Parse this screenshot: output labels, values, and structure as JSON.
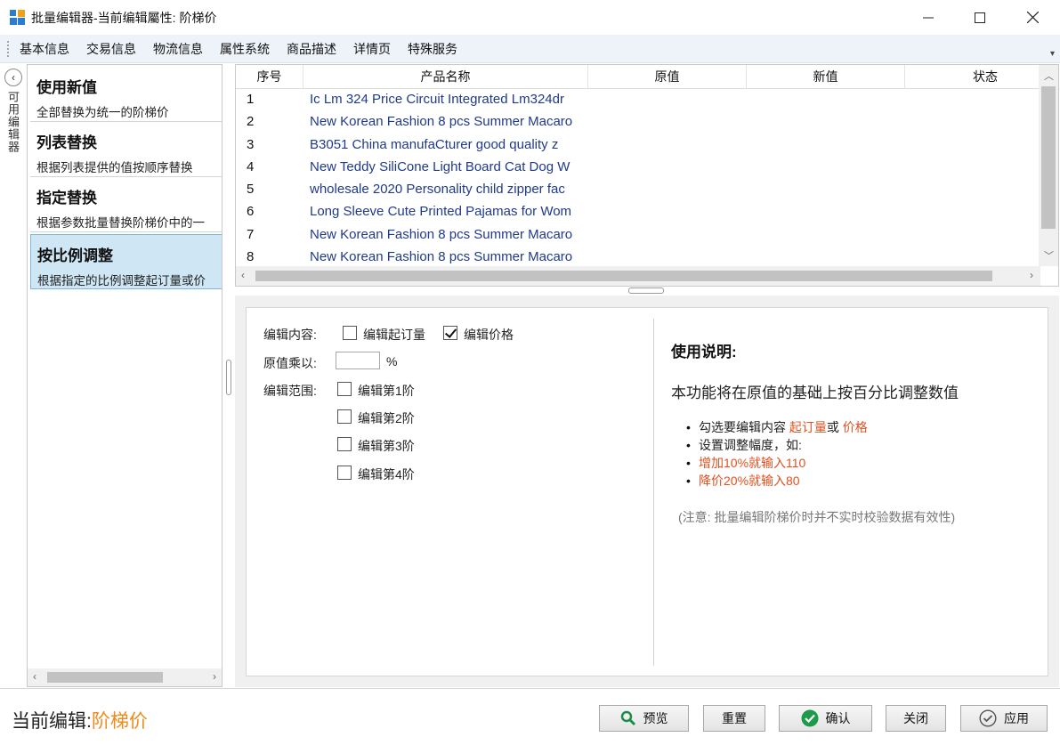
{
  "window": {
    "title": "批量编辑器-当前编辑屬性: 阶梯价",
    "minimize_icon": "minimize-icon",
    "maximize_icon": "maximize-icon",
    "close_icon": "close-icon"
  },
  "menu": {
    "items": [
      "基本信息",
      "交易信息",
      "物流信息",
      "属性系统",
      "商品描述",
      "详情页",
      "特殊服务"
    ]
  },
  "left_strip": {
    "collapse_icon": "chevron-left-icon",
    "label": "可用编辑器"
  },
  "editors": [
    {
      "title": "使用新值",
      "desc": "全部替换为统一的阶梯价"
    },
    {
      "title": "列表替换",
      "desc": "根据列表提供的值按顺序替换"
    },
    {
      "title": "指定替换",
      "desc": "根据参数批量替换阶梯价中的一"
    },
    {
      "title": "按比例调整",
      "desc": "根据指定的比例调整起订量或价",
      "selected": true
    }
  ],
  "table": {
    "headers": [
      "序号",
      "产品名称",
      "原值",
      "新值",
      "状态"
    ],
    "rows": [
      {
        "idx": "1",
        "name": "Ic Lm 324 Price Circuit Integrated Lm324dr"
      },
      {
        "idx": "2",
        "name": "New Korean Fashion 8 pcs Summer Macaro"
      },
      {
        "idx": "3",
        "name": "B3051 China manufaCturer good quality  z"
      },
      {
        "idx": "4",
        "name": "New Teddy SiliCone Light Board Cat  Dog W"
      },
      {
        "idx": "5",
        "name": "wholesale 2020 Personality child zipper fac"
      },
      {
        "idx": "6",
        "name": "Long Sleeve Cute Printed Pajamas for Wom"
      },
      {
        "idx": "7",
        "name": "New Korean Fashion 8 pcs Summer Macaro"
      },
      {
        "idx": "8",
        "name": "New Korean Fashion 8 pcs Summer Macaro"
      }
    ]
  },
  "form": {
    "content_label": "编辑内容:",
    "edit_qty_label": "编辑起订量",
    "edit_qty_checked": false,
    "edit_price_label": "编辑价格",
    "edit_price_checked": true,
    "multiply_label": "原值乘以:",
    "multiply_value": "",
    "percent_sign": "%",
    "range_label": "编辑范围:",
    "tiers": [
      {
        "label": "编辑第1阶",
        "checked": false
      },
      {
        "label": "编辑第2阶",
        "checked": false
      },
      {
        "label": "编辑第3阶",
        "checked": false
      },
      {
        "label": "编辑第4阶",
        "checked": false
      }
    ]
  },
  "help": {
    "title": "使用说明:",
    "main": "本功能将在原值的基础上按百分比调整数值",
    "bullet1_prefix": "勾选要编辑内容 ",
    "bullet1_qty": "起订量",
    "bullet1_or": "或 ",
    "bullet1_price": "价格",
    "bullet2": "设置调整幅度，如:",
    "bullet3": "增加10%就输入110",
    "bullet4": "降价20%就输入80",
    "note": "(注意: 批量编辑阶梯价时并不实时校验数据有效性)",
    "accent_color": "#e2501f"
  },
  "bottom": {
    "current_label": "当前编辑:",
    "current_value": "阶梯价",
    "current_value_color": "#f08a1c",
    "preview": "预览",
    "reset": "重置",
    "confirm": "确认",
    "close": "关闭",
    "apply": "应用"
  }
}
